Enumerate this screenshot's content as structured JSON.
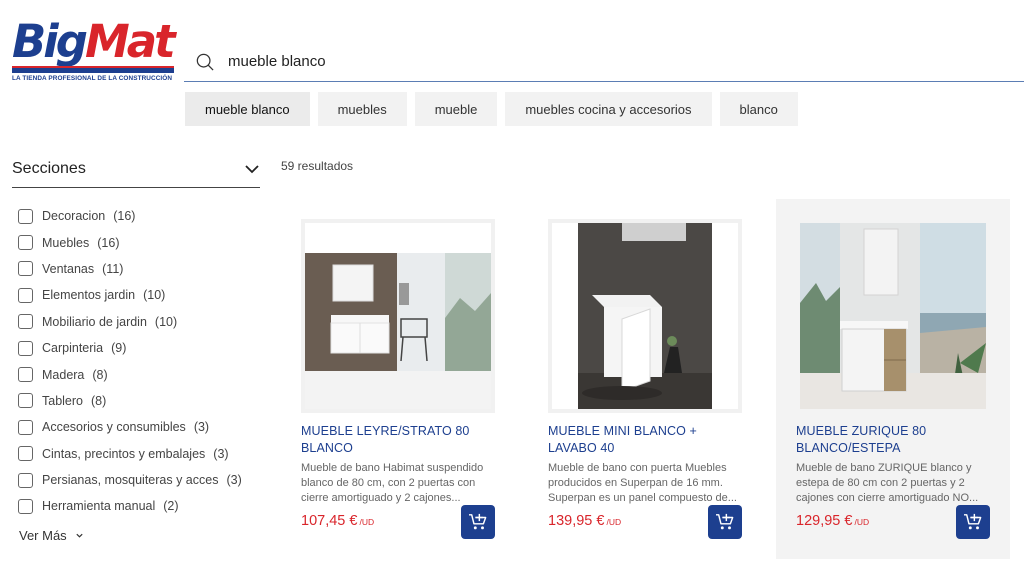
{
  "brand": {
    "logo_part1": "Big",
    "logo_part2": "Mat",
    "tagline": "LA TIENDA PROFESIONAL DE LA CONSTRUCCIÓN",
    "colors": {
      "blue": "#1d3f8f",
      "red": "#d9252b"
    }
  },
  "search": {
    "icon": "search-icon",
    "value": "mueble blanco"
  },
  "suggestions": [
    "mueble blanco",
    "muebles",
    "mueble",
    "muebles cocina y accesorios",
    "blanco"
  ],
  "sidebar": {
    "title": "Secciones",
    "facets": [
      {
        "label": "Decoracion",
        "count": "(16)"
      },
      {
        "label": "Muebles",
        "count": "(16)"
      },
      {
        "label": "Ventanas",
        "count": "(11)"
      },
      {
        "label": "Elementos jardin",
        "count": "(10)"
      },
      {
        "label": "Mobiliario de jardin",
        "count": "(10)"
      },
      {
        "label": "Carpinteria",
        "count": "(9)"
      },
      {
        "label": "Madera",
        "count": "(8)"
      },
      {
        "label": "Tablero",
        "count": "(8)"
      },
      {
        "label": "Accesorios y consumibles",
        "count": "(3)"
      },
      {
        "label": "Cintas, precintos y embalajes",
        "count": "(3)"
      },
      {
        "label": "Persianas, mosquiteras y acces",
        "count": "(3)"
      },
      {
        "label": "Herramienta manual",
        "count": "(2)"
      }
    ],
    "more_label": "Ver Más"
  },
  "results": {
    "count_label": "59 resultados",
    "products": [
      {
        "title": "MUEBLE LEYRE/STRATO 80 BLANCO",
        "description": "Mueble de bano Habimat suspendido blanco de 80 cm, con 2 puertas con cierre amortiguado y 2 cajones...",
        "price": "107,45 €",
        "unit": "/UD"
      },
      {
        "title": "MUEBLE MINI BLANCO + LAVABO 40",
        "description": "Mueble de bano con puerta Muebles producidos en Superpan de 16 mm. Superpan es un panel compuesto de...",
        "price": "139,95 €",
        "unit": "/UD"
      },
      {
        "title": "MUEBLE ZURIQUE 80 BLANCO/ESTEPA",
        "description": "Mueble de bano ZURIQUE blanco y estepa de 80 cm con 2 puertas y 2 cajones con cierre amortiguado NO...",
        "price": "129,95 €",
        "unit": "/UD"
      }
    ]
  }
}
